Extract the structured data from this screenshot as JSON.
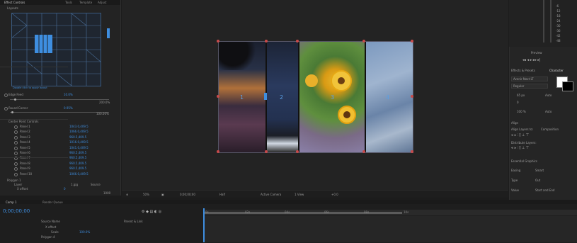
{
  "left_panel": {
    "tabs": [
      "Effect Controls",
      "Tools",
      "Template",
      "Adjust"
    ],
    "section_title": "Layouts",
    "preview_caption": "Double click to apply layout",
    "rows": [
      {
        "label": "Edge Feed",
        "value": "10.0%"
      },
      {
        "label": "Round Corner",
        "value": "0.95%"
      },
      {
        "label": "Center Point Controls",
        "value": ""
      }
    ],
    "slider1_max": "200.0%",
    "slider2_max": "100.00%",
    "panels": [
      {
        "label": "Panel 1",
        "value": "1043.0,409.5"
      },
      {
        "label": "Panel 2",
        "value": "1066.0,409.5"
      },
      {
        "label": "Panel 3",
        "value": "960.5,409.5"
      },
      {
        "label": "Panel 4",
        "value": "1016.0,409.5"
      },
      {
        "label": "Panel 5",
        "value": "1041.0,409.5"
      },
      {
        "label": "Panel 6",
        "value": "960.5,409.5"
      },
      {
        "label": "Panel 7",
        "value": "960.5,409.5"
      },
      {
        "label": "Panel 8",
        "value": "960.5,409.5"
      },
      {
        "label": "Panel 9",
        "value": "960.5,409.5"
      },
      {
        "label": "Panel 10",
        "value": "1066.0,409.5"
      }
    ],
    "polygon_label": "Polygon 1",
    "layer_label": "Layer",
    "layer_value": "1.jpg",
    "source_label": "Source",
    "x_offset_label": "X offset",
    "x_offset_value": "0",
    "bottom_value": "1000"
  },
  "viewer": {
    "panel_numbers": [
      "1",
      "2",
      "3",
      "4"
    ],
    "bar": {
      "zoom": "50%",
      "timecode": "0;00;00;00",
      "quality": "Half",
      "camera": "Active Camera",
      "views": "1 View",
      "offset": "+0.0"
    }
  },
  "right_panel": {
    "meter_labels": [
      "-6",
      "-12",
      "-18",
      "-24",
      "-30",
      "-36",
      "-42",
      "-48"
    ],
    "preview_title": "Preview",
    "char_title": "Effects & Presets",
    "char_tab": "Character",
    "font_name": "Avenir Next LT",
    "font_style": "Regular",
    "size_value": "65 px",
    "leading_value": "Auto",
    "tracking_value": "0",
    "scale_value": "100 %",
    "auto_label": "Auto",
    "align_title": "Align",
    "align_to_label": "Align Layers to:",
    "align_to_value": "Composition",
    "distribute_label": "Distribute Layers:",
    "text_title": "Essential Graphics",
    "rows": [
      {
        "label": "Easing",
        "value": "Smart"
      },
      {
        "label": "Type",
        "value": "Out"
      },
      {
        "label": "Value",
        "value": "Start and End"
      }
    ]
  },
  "timeline": {
    "tabs": [
      "Comp 1",
      "Render Queue"
    ],
    "timecode": "0;00;00;00",
    "ticks": [
      "0s",
      "02s",
      "04s",
      "06s",
      "08s",
      "10s"
    ],
    "columns": [
      "Source Name",
      "Parent & Link"
    ],
    "rows": [
      {
        "label": "X offset",
        "value": ""
      },
      {
        "label": "Scale",
        "value": "100.0%"
      },
      {
        "label": "Polygon 4",
        "value": ""
      }
    ]
  }
}
